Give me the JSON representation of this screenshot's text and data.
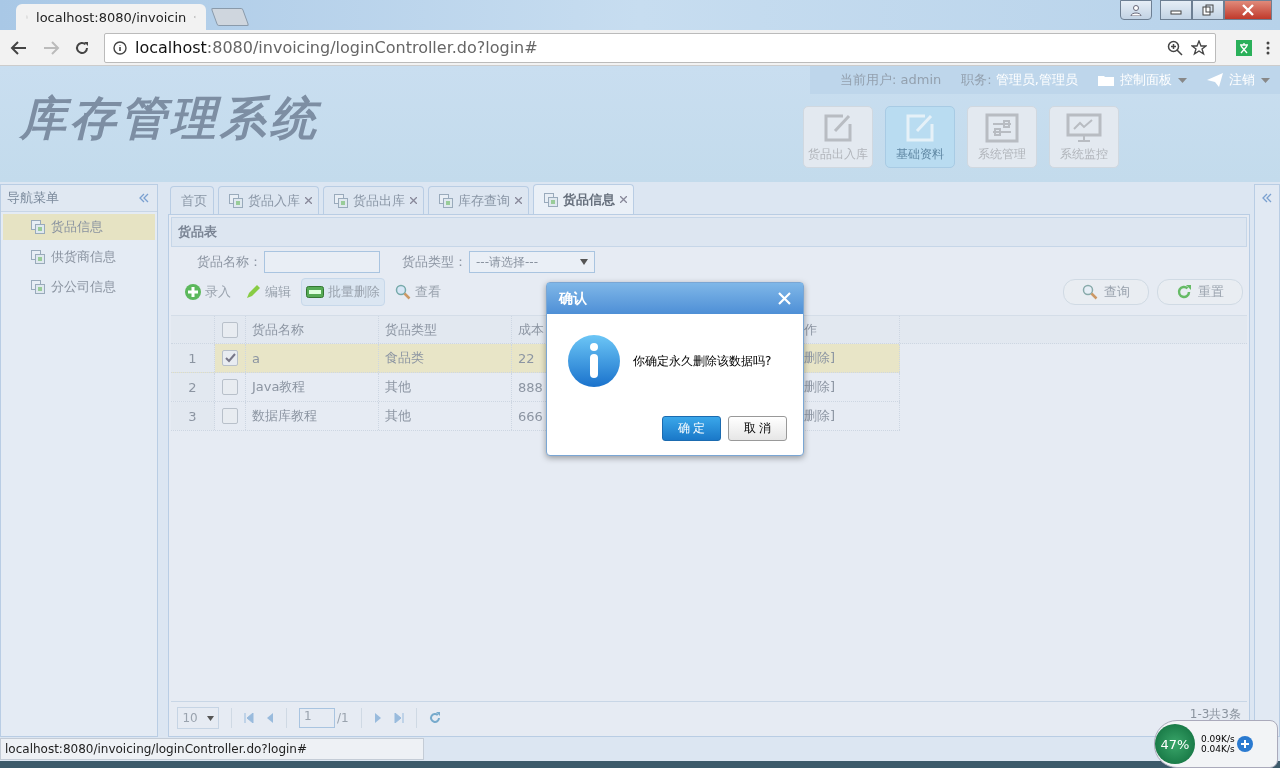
{
  "browser": {
    "tab_title": "localhost:8080/invoicin",
    "url_host": "localhost",
    "url_path": ":8080/invoicing/loginController.do?login#",
    "status_url": "localhost:8080/invoicing/loginController.do?login#"
  },
  "header": {
    "logo": "库存管理系统",
    "user_label": "当前用户:",
    "user": "admin",
    "role_label": "职务:",
    "role": "管理员,管理员",
    "menus": [
      {
        "label": "控制面板",
        "kind": "folder"
      },
      {
        "label": "注销",
        "kind": "plane"
      }
    ],
    "modules": [
      {
        "label": "货品出入库",
        "kind": "edit",
        "selected": false
      },
      {
        "label": "基础资料",
        "kind": "edit",
        "selected": true
      },
      {
        "label": "系统管理",
        "kind": "sliders",
        "selected": false
      },
      {
        "label": "系统监控",
        "kind": "monitor",
        "selected": false
      }
    ]
  },
  "sidebar": {
    "title": "导航菜单",
    "items": [
      {
        "label": "货品信息",
        "selected": true
      },
      {
        "label": "供货商信息",
        "selected": false
      },
      {
        "label": "分公司信息",
        "selected": false
      }
    ]
  },
  "tabs": [
    {
      "label": "首页",
      "closable": false,
      "selected": false
    },
    {
      "label": "货品入库",
      "closable": true,
      "selected": false
    },
    {
      "label": "货品出库",
      "closable": true,
      "selected": false
    },
    {
      "label": "库存查询",
      "closable": true,
      "selected": false
    },
    {
      "label": "货品信息",
      "closable": true,
      "selected": true
    }
  ],
  "panel": {
    "title": "货品表",
    "filters": [
      {
        "label": "货品名称：",
        "kind": "input"
      },
      {
        "label": "货品类型：",
        "kind": "select",
        "value": "---请选择---"
      }
    ],
    "toolbar": [
      {
        "label": "录入",
        "kind": "add"
      },
      {
        "label": "编辑",
        "kind": "edit"
      },
      {
        "label": "批量删除",
        "kind": "remove"
      },
      {
        "label": "查看",
        "kind": "view"
      }
    ],
    "search_buttons": [
      {
        "label": "查询",
        "kind": "search"
      },
      {
        "label": "重置",
        "kind": "reset"
      }
    ],
    "all_checked": false,
    "columns": [
      "货品名称",
      "货品类型",
      "成本",
      "作"
    ],
    "rows": [
      {
        "index": "1",
        "checked": true,
        "selected": true,
        "cells": [
          "a",
          "食品类",
          "22",
          "删除]"
        ]
      },
      {
        "index": "2",
        "checked": false,
        "selected": false,
        "cells": [
          "Java教程",
          "其他",
          "888",
          "删除]"
        ]
      },
      {
        "index": "3",
        "checked": false,
        "selected": false,
        "cells": [
          "数据库教程",
          "其他",
          "666",
          "删除]"
        ]
      }
    ],
    "pager": {
      "page_size": "10",
      "page": "1",
      "pages": "/1",
      "summary": "1-3共3条"
    }
  },
  "dialog": {
    "title": "确认",
    "message": "你确定永久删除该数据吗?",
    "buttons": [
      {
        "label": "确 定",
        "primary": true
      },
      {
        "label": "取 消",
        "primary": false
      }
    ]
  },
  "net_widget": {
    "percent": "47%",
    "up": "0.09K/s",
    "down": "0.04K/s"
  }
}
